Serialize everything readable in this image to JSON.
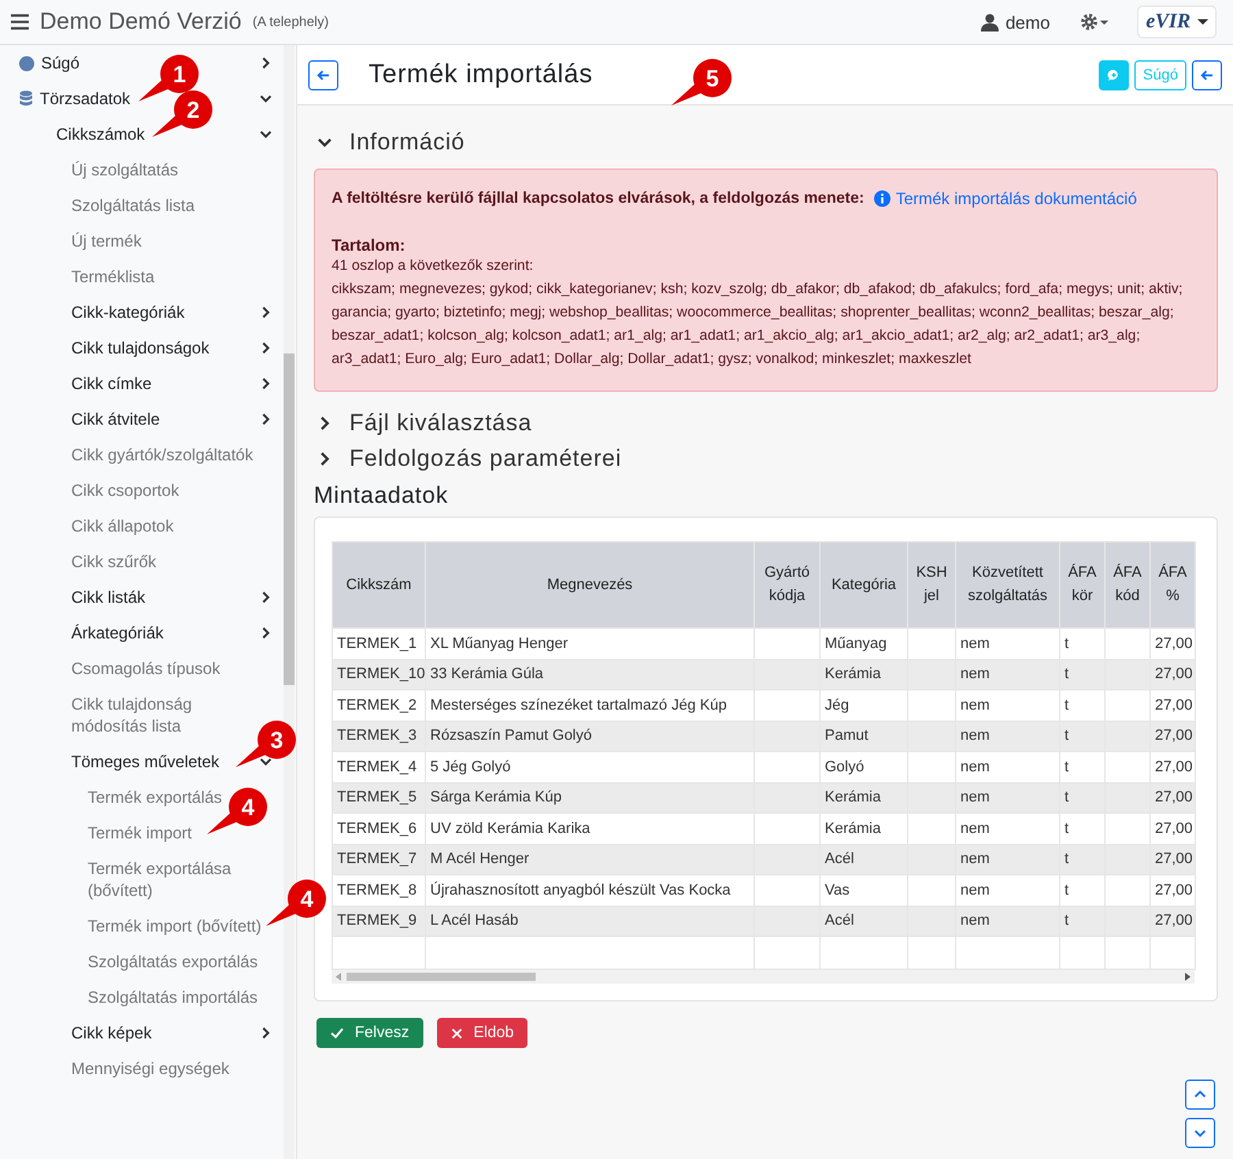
{
  "header": {
    "title": "Demo Demó Verzió",
    "subtitle": "(A telephely)",
    "user": "demo",
    "logo": "eVIR"
  },
  "sidebar": {
    "items": [
      {
        "label": "Súgó",
        "kind": "group",
        "expanded": false
      },
      {
        "label": "Törzsadatok",
        "kind": "group",
        "expanded": true,
        "children": [
          {
            "label": "Cikkszámok",
            "kind": "group",
            "expanded": true,
            "children": [
              {
                "label": "Új szolgáltatás",
                "kind": "link"
              },
              {
                "label": "Szolgáltatás lista",
                "kind": "link"
              },
              {
                "label": "Új termék",
                "kind": "link"
              },
              {
                "label": "Terméklista",
                "kind": "link"
              },
              {
                "label": "Cikk-kategóriák",
                "kind": "group",
                "expanded": false
              },
              {
                "label": "Cikk tulajdonságok",
                "kind": "group",
                "expanded": false
              },
              {
                "label": "Cikk címke",
                "kind": "group",
                "expanded": false
              },
              {
                "label": "Cikk átvitele",
                "kind": "group",
                "expanded": false
              },
              {
                "label": "Cikk gyártók/szolgáltatók",
                "kind": "link"
              },
              {
                "label": "Cikk csoportok",
                "kind": "link"
              },
              {
                "label": "Cikk állapotok",
                "kind": "link"
              },
              {
                "label": "Cikk szűrők",
                "kind": "link"
              },
              {
                "label": "Cikk listák",
                "kind": "group",
                "expanded": false
              },
              {
                "label": "Árkategóriák",
                "kind": "group",
                "expanded": false
              },
              {
                "label": "Csomagolás típusok",
                "kind": "link"
              },
              {
                "label": "Cikk tulajdonság módosítás lista",
                "kind": "link"
              },
              {
                "label": "Tömeges műveletek",
                "kind": "group",
                "expanded": true,
                "children": [
                  {
                    "label": "Termék exportálás",
                    "kind": "link"
                  },
                  {
                    "label": "Termék import",
                    "kind": "link"
                  },
                  {
                    "label": "Termék exportálása (bővített)",
                    "kind": "link"
                  },
                  {
                    "label": "Termék import (bővített)",
                    "kind": "link"
                  },
                  {
                    "label": "Szolgáltatás exportálás",
                    "kind": "link"
                  },
                  {
                    "label": "Szolgáltatás importálás",
                    "kind": "link"
                  }
                ]
              },
              {
                "label": "Cikk képek",
                "kind": "group",
                "expanded": false
              },
              {
                "label": "Mennyiségi egységek",
                "kind": "link"
              }
            ]
          }
        ]
      }
    ]
  },
  "page": {
    "title": "Termék importálás",
    "help_button": "Súgó"
  },
  "sections": [
    {
      "title": "Információ",
      "expanded": true
    },
    {
      "title": "Fájl kiválasztása",
      "expanded": false
    },
    {
      "title": "Feldolgozás paraméterei",
      "expanded": false
    }
  ],
  "info": {
    "intro": "A feltöltésre kerülő fájllal kapcsolatos elvárások, a feldolgozás menete:",
    "link": "Termék importálás dokumentáció",
    "heading": "Tartalom:",
    "count_line": "41 oszlop a következők szerint:",
    "columns_text": "cikkszam; megnevezes; gykod; cikk_kategorianev; ksh; kozv_szolg; db_afakor; db_afakod; db_afakulcs; ford_afa; megys; unit; aktiv; garancia; gyarto; biztetinfo; megj; webshop_beallitas; woocommerce_beallitas; shoprenter_beallitas; wconn2_beallitas; beszar_alg; beszar_adat1; kolcson_alg; kolcson_adat1; ar1_alg; ar1_adat1; ar1_akcio_alg; ar1_akcio_adat1; ar2_alg; ar2_adat1; ar3_alg; ar3_adat1; Euro_alg; Euro_adat1; Dollar_alg; Dollar_adat1; gysz; vonalkod; minkeszlet; maxkeszlet"
  },
  "sample": {
    "title": "Mintaadatok",
    "columns": [
      "Cikkszám",
      "Megnevezés",
      "Gyártó kódja",
      "Kategória",
      "KSH jel",
      "Közvetített szolgáltatás",
      "ÁFA kör",
      "ÁFA kód",
      "ÁFA %"
    ],
    "rows": [
      [
        "TERMEK_1",
        "XL Műanyag Henger",
        "",
        "Műanyag",
        "",
        "nem",
        "t",
        "",
        "27,00"
      ],
      [
        "TERMEK_10",
        "33 Kerámia Gúla",
        "",
        "Kerámia",
        "",
        "nem",
        "t",
        "",
        "27,00"
      ],
      [
        "TERMEK_2",
        "Mesterséges színezéket tartalmazó Jég Kúp",
        "",
        "Jég",
        "",
        "nem",
        "t",
        "",
        "27,00"
      ],
      [
        "TERMEK_3",
        "Rózsaszín Pamut Golyó",
        "",
        "Pamut",
        "",
        "nem",
        "t",
        "",
        "27,00"
      ],
      [
        "TERMEK_4",
        "5 Jég Golyó",
        "",
        "Golyó",
        "",
        "nem",
        "t",
        "",
        "27,00"
      ],
      [
        "TERMEK_5",
        "Sárga Kerámia Kúp",
        "",
        "Kerámia",
        "",
        "nem",
        "t",
        "",
        "27,00"
      ],
      [
        "TERMEK_6",
        "UV zöld Kerámia Karika",
        "",
        "Kerámia",
        "",
        "nem",
        "t",
        "",
        "27,00"
      ],
      [
        "TERMEK_7",
        "M Acél Henger",
        "",
        "Acél",
        "",
        "nem",
        "t",
        "",
        "27,00"
      ],
      [
        "TERMEK_8",
        "Újrahasznosított anyagból készült Vas Kocka",
        "",
        "Vas",
        "",
        "nem",
        "t",
        "",
        "27,00"
      ],
      [
        "TERMEK_9",
        "L Acél Hasáb",
        "",
        "Acél",
        "",
        "nem",
        "t",
        "",
        "27,00"
      ]
    ]
  },
  "actions": [
    {
      "label": "Felvesz",
      "kind": "confirm"
    },
    {
      "label": "Eldob",
      "kind": "discard"
    }
  ],
  "callouts": [
    {
      "number": "1"
    },
    {
      "number": "2"
    },
    {
      "number": "3"
    },
    {
      "number": "4"
    },
    {
      "number": "4"
    },
    {
      "number": "5"
    }
  ]
}
